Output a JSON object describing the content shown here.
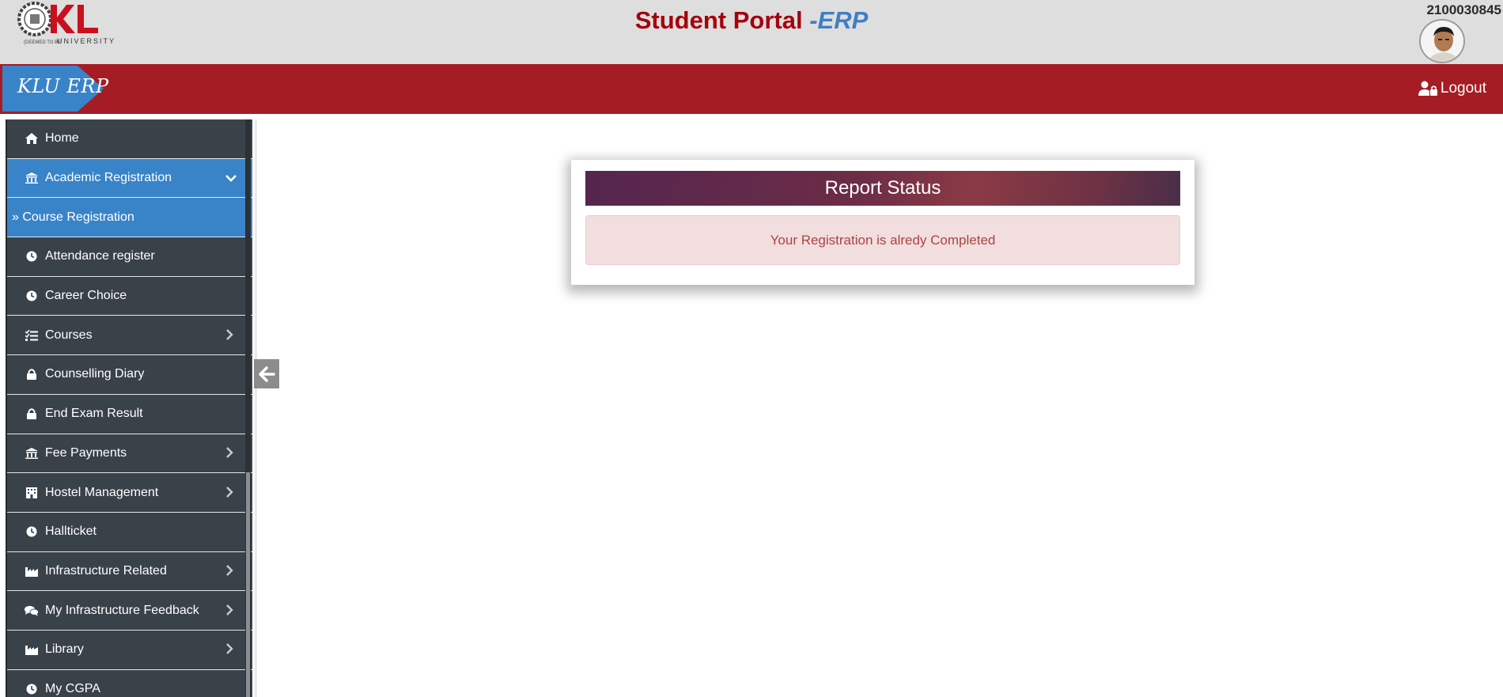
{
  "header": {
    "logo_alt": "KL University",
    "title_main": "Student Portal ",
    "title_accent": "-ERP",
    "student_id": "2100030845"
  },
  "navbar": {
    "brand": "KLU ERP",
    "logout_label": "Logout"
  },
  "sidebar": {
    "items": [
      {
        "label": "Home",
        "icon": "home-icon"
      },
      {
        "label": "Academic Registration",
        "icon": "institution-icon",
        "chevron": "down"
      },
      {
        "label": "» Course Registration",
        "icon": "",
        "active": true
      },
      {
        "label": "Attendance register",
        "icon": "clock-icon"
      },
      {
        "label": "Career Choice",
        "icon": "clock-icon"
      },
      {
        "label": "Courses",
        "icon": "tasks-icon",
        "chevron": "right"
      },
      {
        "label": "Counselling Diary",
        "icon": "lock-icon"
      },
      {
        "label": "End Exam Result",
        "icon": "lock-icon"
      },
      {
        "label": "Fee Payments",
        "icon": "institution-icon",
        "chevron": "right"
      },
      {
        "label": "Hostel Management",
        "icon": "building-icon",
        "chevron": "right"
      },
      {
        "label": "Hallticket",
        "icon": "clock-icon"
      },
      {
        "label": "Infrastructure Related",
        "icon": "industry-icon",
        "chevron": "right"
      },
      {
        "label": "My Infrastructure Feedback",
        "icon": "comments-icon",
        "chevron": "right"
      },
      {
        "label": "Library",
        "icon": "industry-icon",
        "chevron": "right"
      },
      {
        "label": "My CGPA",
        "icon": "clock-icon"
      }
    ]
  },
  "report": {
    "title": "Report Status",
    "message": "Your Registration is alredy Completed"
  },
  "colors": {
    "header_bg": "#dedede",
    "navbar_red": "#a51c24",
    "brand_blue": "#3984c8",
    "sidebar_bg": "#3a4249",
    "alert_text": "#a94442",
    "alert_bg": "#f2dede"
  }
}
